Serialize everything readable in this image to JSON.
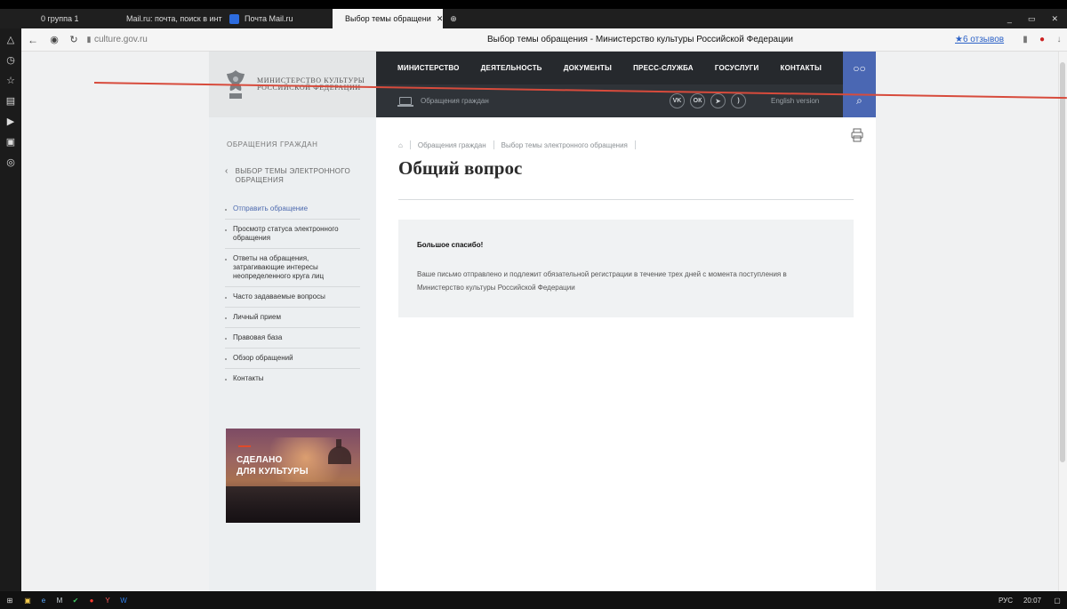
{
  "browser": {
    "tabs": [
      {
        "label": "0 группа 1",
        "active": false
      },
      {
        "label": "Mail.ru: почта, поиск в инт",
        "active": false
      },
      {
        "label": "Почта Mail.ru",
        "active": false
      },
      {
        "label": "Выбор темы обращени",
        "active": true
      }
    ],
    "address_domain": "culture.gov.ru",
    "page_title": "Выбор темы обращения - Министерство культуры Российской Федерации",
    "reviews_label": "★6 отзывов"
  },
  "site": {
    "logo_text_line1": "Министерство культуры",
    "logo_text_line2": "Российской Федерации",
    "nav_items": [
      "МИНИСТЕРСТВО",
      "ДЕЯТЕЛЬНОСТЬ",
      "ДОКУМЕНТЫ",
      "ПРЕСС-СЛУЖБА",
      "ГОСУСЛУГИ",
      "КОНТАКТЫ"
    ],
    "subnav_label": "Обращения граждан",
    "english_label": "English version",
    "socials": [
      "vk-icon",
      "ok-icon",
      "telegram-icon",
      "rss-icon"
    ]
  },
  "sidebar": {
    "section_title": "ОБРАЩЕНИЯ ГРАЖДАН",
    "back_label": "ВЫБОР ТЕМЫ ЭЛЕКТРОННОГО ОБРАЩЕНИЯ",
    "items": [
      {
        "label": "Отправить обращение",
        "active": true
      },
      {
        "label": "Просмотр статуса электронного обращения",
        "active": false
      },
      {
        "label": "Ответы на обращения, затрагивающие интересы неопределенного круга лиц",
        "active": false
      },
      {
        "label": "Часто задаваемые вопросы",
        "active": false
      },
      {
        "label": "Личный прием",
        "active": false
      },
      {
        "label": "Правовая база",
        "active": false
      },
      {
        "label": "Обзор обращений",
        "active": false
      },
      {
        "label": "Контакты",
        "active": false
      }
    ],
    "promo_text_line1": "СДЕЛАНО",
    "promo_text_line2": "ДЛЯ КУЛЬТУРЫ"
  },
  "content": {
    "breadcrumb": [
      "Обращения граждан",
      "Выбор темы электронного обращения"
    ],
    "title": "Общий вопрос",
    "notice_heading": "Большое спасибо!",
    "notice_text": "Ваше письмо отправлено и подлежит обязательной регистрации в течение трех дней с момента поступления в Министерство культуры Российской Федерации"
  },
  "taskbar": {
    "lang": "РУС",
    "time": "20:07"
  },
  "colors": {
    "nav_bg": "#26292d",
    "accent_blue": "#4a67b3",
    "active_link": "#4d6aaf",
    "annotation_red": "#d74b3c"
  }
}
